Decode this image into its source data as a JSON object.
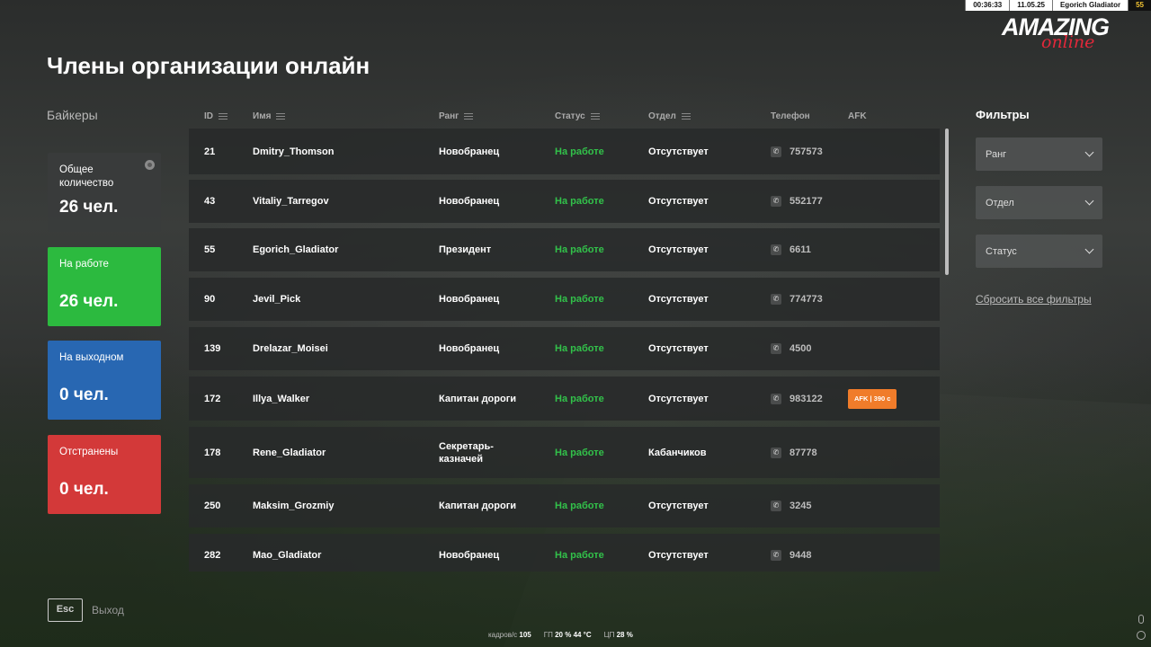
{
  "hud": {
    "time": "00:36:33",
    "date": "11.05.25",
    "player": "Egorich Gladiator",
    "level": "55"
  },
  "logo": {
    "word1": "AMAZING",
    "word2": "online"
  },
  "title": "Члены организации онлайн",
  "org_name": "Байкеры",
  "stats": {
    "total_label": "Общее количество",
    "total_value": "26 чел.",
    "work_label": "На работе",
    "work_value": "26 чел.",
    "off_label": "На выходном",
    "off_value": "0 чел.",
    "susp_label": "Отстранены",
    "susp_value": "0 чел."
  },
  "columns": {
    "id": "ID",
    "name": "Имя",
    "rank": "Ранг",
    "status": "Статус",
    "dept": "Отдел",
    "phone": "Телефон",
    "afk": "AFK"
  },
  "rows": [
    {
      "id": "21",
      "name": "Dmitry_Thomson",
      "rank": "Новобранец",
      "status": "На работе",
      "dept": "Отсутствует",
      "phone": "757573",
      "afk": ""
    },
    {
      "id": "43",
      "name": "Vitaliy_Tarregov",
      "rank": "Новобранец",
      "status": "На работе",
      "dept": "Отсутствует",
      "phone": "552177",
      "afk": ""
    },
    {
      "id": "55",
      "name": "Egorich_Gladiator",
      "rank": "Президент",
      "status": "На работе",
      "dept": "Отсутствует",
      "phone": "6611",
      "afk": ""
    },
    {
      "id": "90",
      "name": "Jevil_Pick",
      "rank": "Новобранец",
      "status": "На работе",
      "dept": "Отсутствует",
      "phone": "774773",
      "afk": ""
    },
    {
      "id": "139",
      "name": "Drelazar_Moisei",
      "rank": "Новобранец",
      "status": "На работе",
      "dept": "Отсутствует",
      "phone": "4500",
      "afk": ""
    },
    {
      "id": "172",
      "name": "Illya_Walker",
      "rank": "Капитан дороги",
      "status": "На работе",
      "dept": "Отсутствует",
      "phone": "983122",
      "afk": "AFK  |  390 с"
    },
    {
      "id": "178",
      "name": "Rene_Gladiator",
      "rank": "Секретарь-казначей",
      "status": "На работе",
      "dept": "Кабанчиков",
      "phone": "87778",
      "afk": ""
    },
    {
      "id": "250",
      "name": "Maksim_Grozmiy",
      "rank": "Капитан дороги",
      "status": "На работе",
      "dept": "Отсутствует",
      "phone": "3245",
      "afk": ""
    },
    {
      "id": "282",
      "name": "Mao_Gladiator",
      "rank": "Новобранец",
      "status": "На работе",
      "dept": "Отсутствует",
      "phone": "9448",
      "afk": ""
    }
  ],
  "filters": {
    "title": "Фильтры",
    "rank": "Ранг",
    "dept": "Отдел",
    "status": "Статус",
    "reset": "Сбросить все фильтры"
  },
  "footer": {
    "esc": "Esc",
    "exit": "Выход",
    "fps_label": "кадров/с",
    "fps": "105",
    "gpu_label": "ГП",
    "gpu_load": "20 %",
    "gpu_temp": "44 °C",
    "cpu_label": "ЦП",
    "cpu_load": "28 %"
  }
}
